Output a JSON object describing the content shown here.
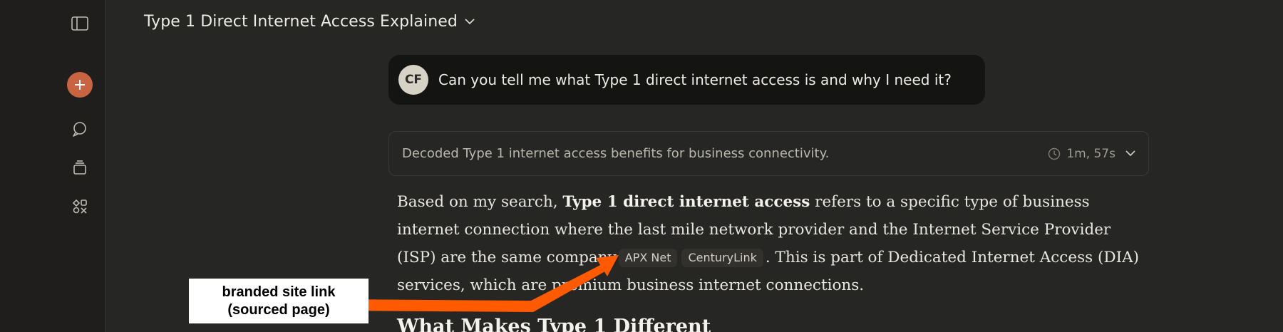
{
  "sidebar": {
    "icons": [
      "sidebar-toggle-icon",
      "plus-icon",
      "chat-icon",
      "projects-icon",
      "artifacts-icon"
    ],
    "accent": "#c96442"
  },
  "header": {
    "title": "Type 1 Direct Internet Access Explained"
  },
  "user_message": {
    "initials": "CF",
    "text": "Can you tell me what Type 1 direct internet access is and why I need it?"
  },
  "thinking": {
    "summary": "Decoded Type 1 internet access benefits for business connectivity.",
    "duration": "1m, 57s"
  },
  "answer": {
    "p1_a": "Based on my search, ",
    "p1_bold": "Type 1 direct internet access",
    "p1_b": " refers to a specific type of business internet connection where the last mile network provider and the Internet Service Provider (ISP) are the same company",
    "chip_1": "APX Net",
    "chip_2": "CenturyLink",
    "p1_c": ". This is part of Dedicated Internet Access (DIA) services, which are premium business internet connections.",
    "heading": "What Makes Type 1 Different"
  },
  "annotation": {
    "line1": "branded site link",
    "line2": "(sourced page)",
    "color": "#ff5a00"
  }
}
